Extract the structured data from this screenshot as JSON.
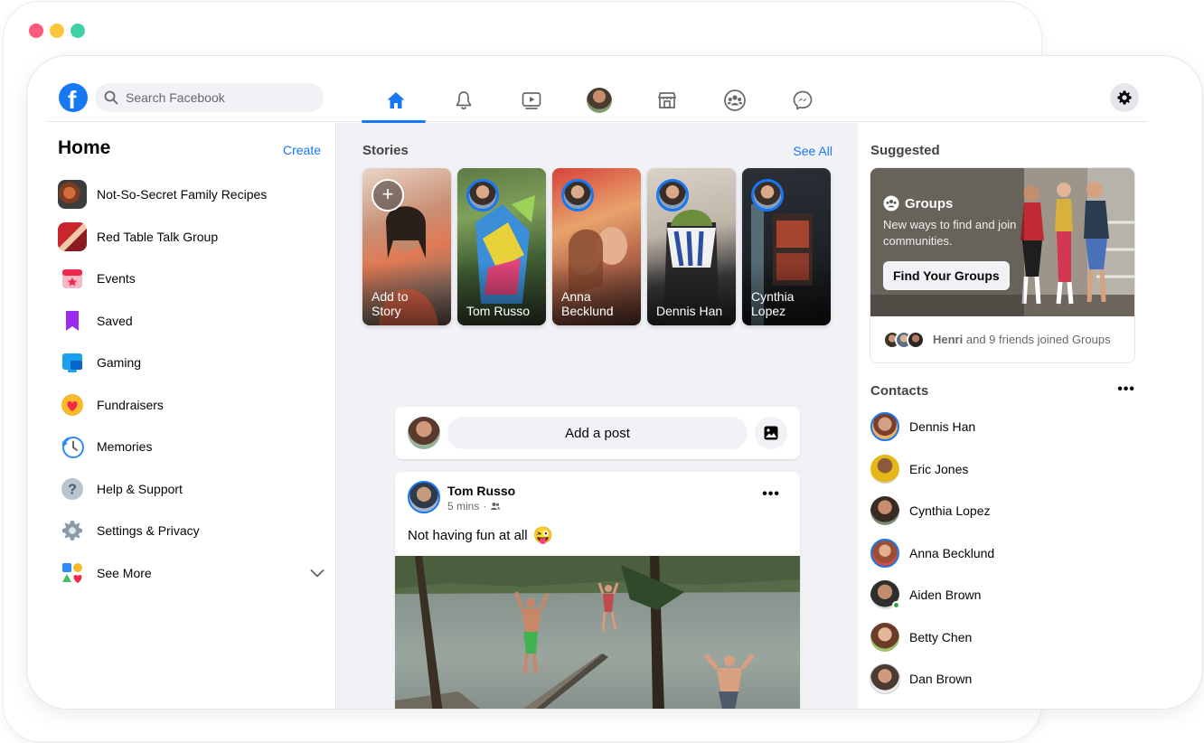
{
  "window_dots": [
    {
      "name": "close",
      "color": "#fc5a7a"
    },
    {
      "name": "minimize",
      "color": "#fcc63a"
    },
    {
      "name": "maximize",
      "color": "#3ed1a8"
    }
  ],
  "brand_color": "#1877f2",
  "topbar": {
    "logo_glyph": "f",
    "search_placeholder": "Search Facebook",
    "nav_tabs": [
      {
        "id": "home",
        "icon": "home-icon",
        "active": true
      },
      {
        "id": "notifications",
        "icon": "bell-icon",
        "active": false
      },
      {
        "id": "watch",
        "icon": "video-icon",
        "active": false
      },
      {
        "id": "profile",
        "icon": "avatar",
        "active": false
      },
      {
        "id": "marketplace",
        "icon": "shop-icon",
        "active": false
      },
      {
        "id": "groups",
        "icon": "groups-icon",
        "active": false
      },
      {
        "id": "messenger",
        "icon": "messenger-icon",
        "active": false
      }
    ],
    "settings_icon": "gear-icon"
  },
  "left": {
    "title": "Home",
    "create_label": "Create",
    "items": [
      {
        "label": "Not-So-Secret Family Recipes",
        "icon": "group-photo-recipes"
      },
      {
        "label": "Red Table Talk Group",
        "icon": "group-photo-redtable"
      },
      {
        "label": "Events",
        "icon": "calendar-icon"
      },
      {
        "label": "Saved",
        "icon": "bookmark-icon"
      },
      {
        "label": "Gaming",
        "icon": "gaming-icon"
      },
      {
        "label": "Fundraisers",
        "icon": "heart-icon"
      },
      {
        "label": "Memories",
        "icon": "clock-icon"
      },
      {
        "label": "Help & Support",
        "icon": "question-icon"
      },
      {
        "label": "Settings & Privacy",
        "icon": "gear-icon"
      },
      {
        "label": "See More",
        "icon": "shapes-icon"
      }
    ]
  },
  "stories": {
    "title": "Stories",
    "see_all_label": "See All",
    "items": [
      {
        "name_line1": "Add to",
        "name_line2": "Story",
        "add": true
      },
      {
        "name_line1": "Tom Russo",
        "name_line2": "",
        "add": false
      },
      {
        "name_line1": "Anna",
        "name_line2": "Becklund",
        "add": false
      },
      {
        "name_line1": "Dennis Han",
        "name_line2": "",
        "add": false
      },
      {
        "name_line1": "Cynthia",
        "name_line2": "Lopez",
        "add": false
      }
    ]
  },
  "composer": {
    "placeholder": "Add a post",
    "photo_icon": "photo-icon"
  },
  "post": {
    "author": "Tom Russo",
    "time": "5 mins",
    "separator": "·",
    "audience_icon": "friends-icon",
    "text": "Not having fun at all",
    "emoji": "😜",
    "more_label": "•••"
  },
  "suggested": {
    "title": "Suggested",
    "card_title": "Groups",
    "card_desc": "New ways to find and join communities.",
    "button_label": "Find Your Groups",
    "footer_name": "Henri",
    "footer_text": "and 9 friends joined Groups"
  },
  "contacts": {
    "title": "Contacts",
    "more_label": "•••",
    "items": [
      {
        "name": "Dennis Han",
        "story": true,
        "online": false
      },
      {
        "name": "Eric Jones",
        "story": false,
        "online": false
      },
      {
        "name": "Cynthia Lopez",
        "story": false,
        "online": false
      },
      {
        "name": "Anna Becklund",
        "story": true,
        "online": false
      },
      {
        "name": "Aiden Brown",
        "story": false,
        "online": true
      },
      {
        "name": "Betty Chen",
        "story": false,
        "online": false
      },
      {
        "name": "Dan Brown",
        "story": false,
        "online": false
      }
    ]
  }
}
